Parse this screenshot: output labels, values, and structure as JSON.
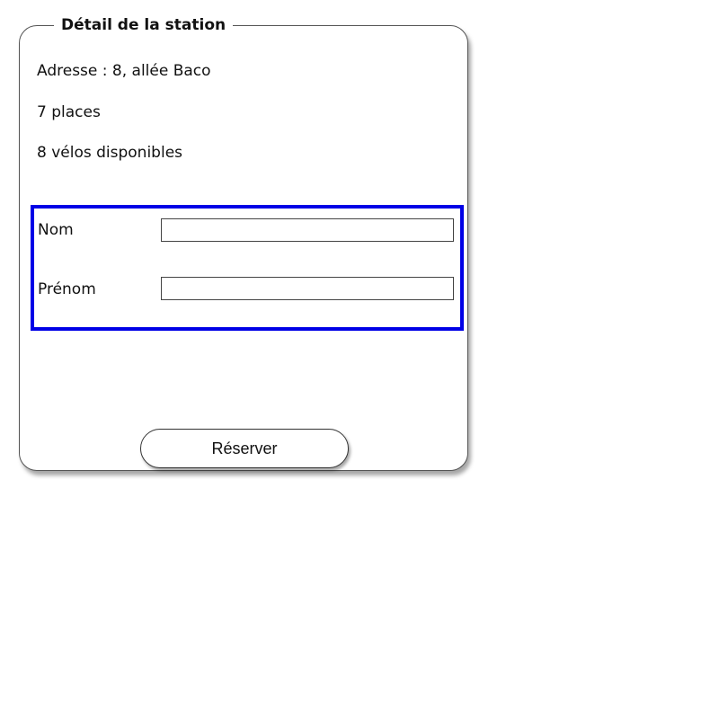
{
  "panel": {
    "legend": "Détail de la station",
    "address": "Adresse : 8, allée Baco",
    "places": "7 places",
    "bikes_available": "8 vélos disponibles"
  },
  "form": {
    "border_color": "#0000e6",
    "fields": [
      {
        "label": "Nom",
        "value": "",
        "placeholder": ""
      },
      {
        "label": "Prénom",
        "value": "",
        "placeholder": ""
      }
    ]
  },
  "actions": {
    "reserve_label": "Réserver"
  }
}
